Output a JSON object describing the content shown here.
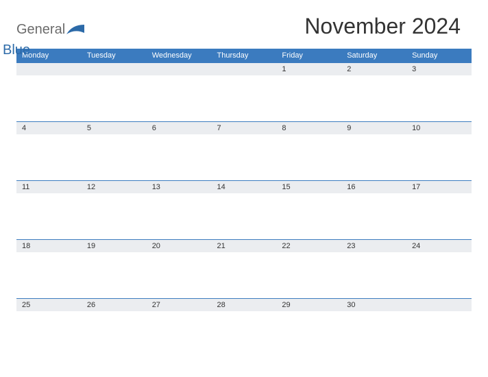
{
  "brand": {
    "word1": "General",
    "word2": "Blue",
    "accent_color": "#3b7bbf"
  },
  "calendar": {
    "title": "November 2024",
    "day_headers": [
      "Monday",
      "Tuesday",
      "Wednesday",
      "Thursday",
      "Friday",
      "Saturday",
      "Sunday"
    ],
    "weeks": [
      [
        "",
        "",
        "",
        "",
        "1",
        "2",
        "3"
      ],
      [
        "4",
        "5",
        "6",
        "7",
        "8",
        "9",
        "10"
      ],
      [
        "11",
        "12",
        "13",
        "14",
        "15",
        "16",
        "17"
      ],
      [
        "18",
        "19",
        "20",
        "21",
        "22",
        "23",
        "24"
      ],
      [
        "25",
        "26",
        "27",
        "28",
        "29",
        "30",
        ""
      ]
    ]
  }
}
